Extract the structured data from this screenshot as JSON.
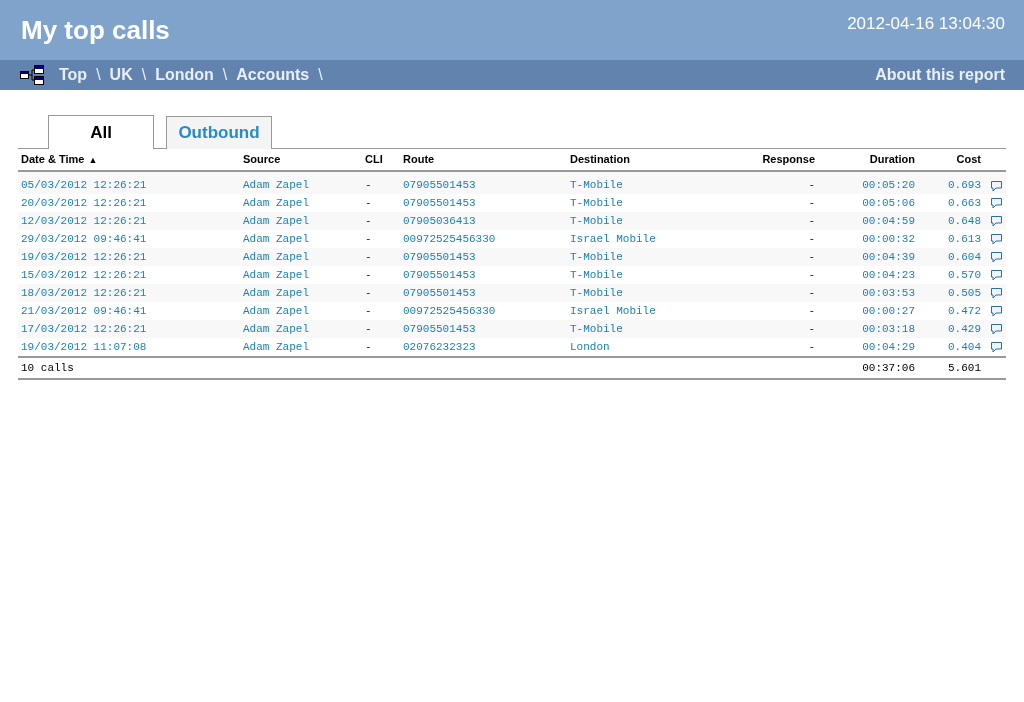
{
  "header": {
    "title": "My top calls",
    "timestamp": "2012-04-16 13:04:30"
  },
  "breadcrumbs": [
    {
      "label": "Top",
      "separator": "\\"
    },
    {
      "label": "UK",
      "separator": "\\"
    },
    {
      "label": "London",
      "separator": "\\"
    },
    {
      "label": "Accounts",
      "separator": "\\"
    }
  ],
  "about_link": "About this report",
  "tabs": [
    {
      "label": "All",
      "selected": true
    },
    {
      "label": "Outbound",
      "selected": false
    }
  ],
  "table": {
    "columns": [
      {
        "label": "Date & Time",
        "sort": "▲"
      },
      {
        "label": "Source"
      },
      {
        "label": "CLI"
      },
      {
        "label": "Route"
      },
      {
        "label": "Destination"
      },
      {
        "label": "Response"
      },
      {
        "label": "Duration"
      },
      {
        "label": "Cost"
      }
    ],
    "rows": [
      [
        "05/03/2012 12:26:21",
        "Adam Zapel",
        "-",
        "07905501453",
        "T-Mobile",
        "-",
        "00:05:20",
        "0.693"
      ],
      [
        "20/03/2012 12:26:21",
        "Adam Zapel",
        "-",
        "07905501453",
        "T-Mobile",
        "-",
        "00:05:06",
        "0.663"
      ],
      [
        "12/03/2012 12:26:21",
        "Adam Zapel",
        "-",
        "07905036413",
        "T-Mobile",
        "-",
        "00:04:59",
        "0.648"
      ],
      [
        "29/03/2012 09:46:41",
        "Adam Zapel",
        "-",
        "00972525456330",
        "Israel Mobile",
        "-",
        "00:00:32",
        "0.613"
      ],
      [
        "19/03/2012 12:26:21",
        "Adam Zapel",
        "-",
        "07905501453",
        "T-Mobile",
        "-",
        "00:04:39",
        "0.604"
      ],
      [
        "15/03/2012 12:26:21",
        "Adam Zapel",
        "-",
        "07905501453",
        "T-Mobile",
        "-",
        "00:04:23",
        "0.570"
      ],
      [
        "18/03/2012 12:26:21",
        "Adam Zapel",
        "-",
        "07905501453",
        "T-Mobile",
        "-",
        "00:03:53",
        "0.505"
      ],
      [
        "21/03/2012 09:46:41",
        "Adam Zapel",
        "-",
        "00972525456330",
        "Israel Mobile",
        "-",
        "00:00:27",
        "0.472"
      ],
      [
        "17/03/2012 12:26:21",
        "Adam Zapel",
        "-",
        "07905501453",
        "T-Mobile",
        "-",
        "00:03:18",
        "0.429"
      ],
      [
        "19/03/2012 11:07:08",
        "Adam Zapel",
        "-",
        "02076232323",
        "London",
        "-",
        "00:04:29",
        "0.404"
      ]
    ],
    "footer": {
      "count": "10 calls",
      "duration": "00:37:06",
      "cost": "5.601"
    }
  }
}
